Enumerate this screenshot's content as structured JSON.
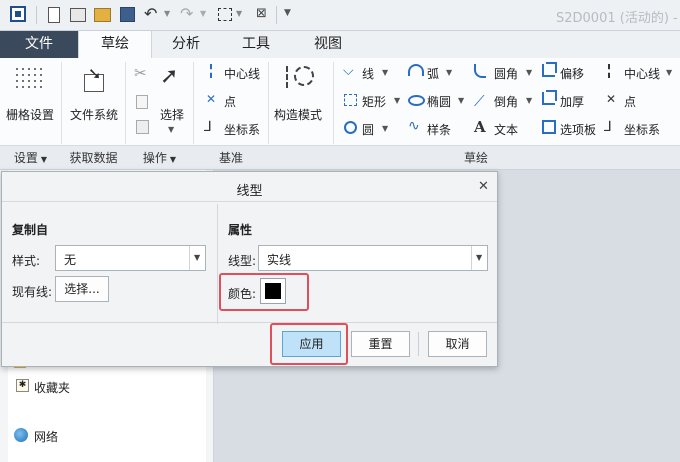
{
  "title_bar": {
    "document_title": "S2D0001 (活动的) -"
  },
  "tabs": [
    {
      "label": "文件"
    },
    {
      "label": "草绘"
    },
    {
      "label": "分析"
    },
    {
      "label": "工具"
    },
    {
      "label": "视图"
    }
  ],
  "ribbon": {
    "grid_settings": "栅格设置",
    "file_system": "文件系统",
    "select": "选择",
    "centerline": "中心线",
    "point": "点",
    "coord_sys": "坐标系",
    "construction_mode": "构造模式",
    "line": "线",
    "rectangle": "矩形",
    "circle": "圆",
    "arc": "弧",
    "ellipse": "椭圆",
    "spline": "样条",
    "fillet": "圆角",
    "chamfer": "倒角",
    "text": "文本",
    "offset": "偏移",
    "thicken": "加厚",
    "palette": "选项板",
    "centerline2": "中心线",
    "point2": "点",
    "coord_sys2": "坐标系"
  },
  "groups": {
    "settings": "设置",
    "get_data": "获取数据",
    "operations": "操作",
    "datum": "基准",
    "sketch": "草绘"
  },
  "dialog": {
    "title": "线型",
    "copy_from_header": "复制自",
    "style_label": "样式:",
    "style_value": "无",
    "existing_line_label": "现有线:",
    "select_button": "选择...",
    "properties_header": "属性",
    "linetype_label": "线型:",
    "linetype_value": "实线",
    "color_label": "颜色:",
    "color_value": "#000000",
    "apply": "应用",
    "reset": "重置",
    "cancel": "取消"
  },
  "folder_tree": {
    "favorites": "收藏夹",
    "network": "网络"
  },
  "colors": {
    "accent_tab": "#3a4a5c",
    "apply_bg": "#bfe2f8",
    "highlight_box": "#e0505c"
  }
}
